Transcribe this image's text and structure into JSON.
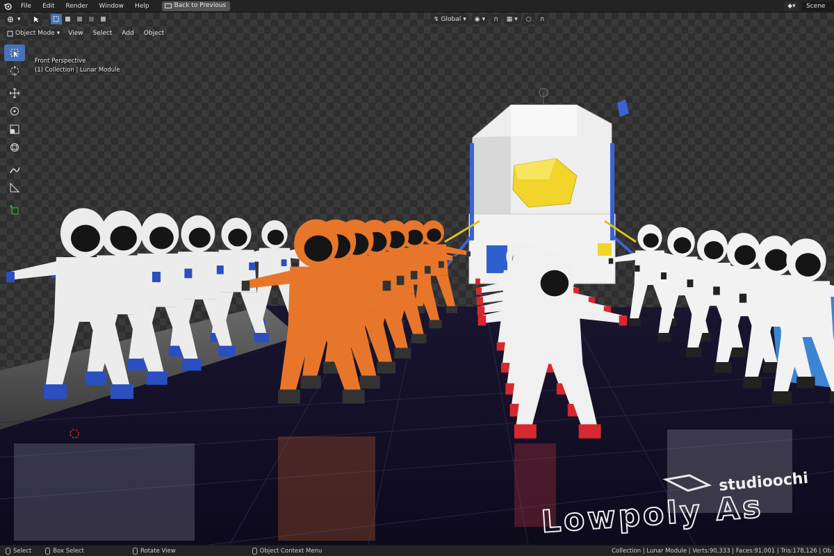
{
  "menu": {
    "items": [
      "File",
      "Edit",
      "Render",
      "Window",
      "Help"
    ],
    "back_label": "Back to Previous"
  },
  "scene": {
    "name": "Scene"
  },
  "header": {
    "mode": "Object Mode",
    "menus": [
      "View",
      "Select",
      "Add",
      "Object"
    ],
    "orientation": "Global"
  },
  "viewport": {
    "view_name": "Front Perspective",
    "collection_line": "(1) Collection | Lunar Module"
  },
  "watermark": {
    "brand": "studioochi",
    "title": "Lowpoly As"
  },
  "statusbar": {
    "select": "Select",
    "box_select": "Box Select",
    "rotate_view": "Rotate View",
    "context_menu": "Object Context Menu",
    "stats": "Collection | Lunar Module | Verts:90,333 | Faces:91,001 | Tris:178,126 | Ob"
  },
  "icons": {
    "toolbar": [
      "select-box-icon",
      "cursor-icon",
      "move-icon",
      "rotate-icon",
      "scale-icon",
      "transform-icon",
      "annotate-icon",
      "measure-icon",
      "add-cube-icon"
    ]
  },
  "colors": {
    "accent": "#4772b3",
    "orange_suit": "#e8762a",
    "red_stripe": "#d8282f",
    "floor": "#120f24"
  }
}
